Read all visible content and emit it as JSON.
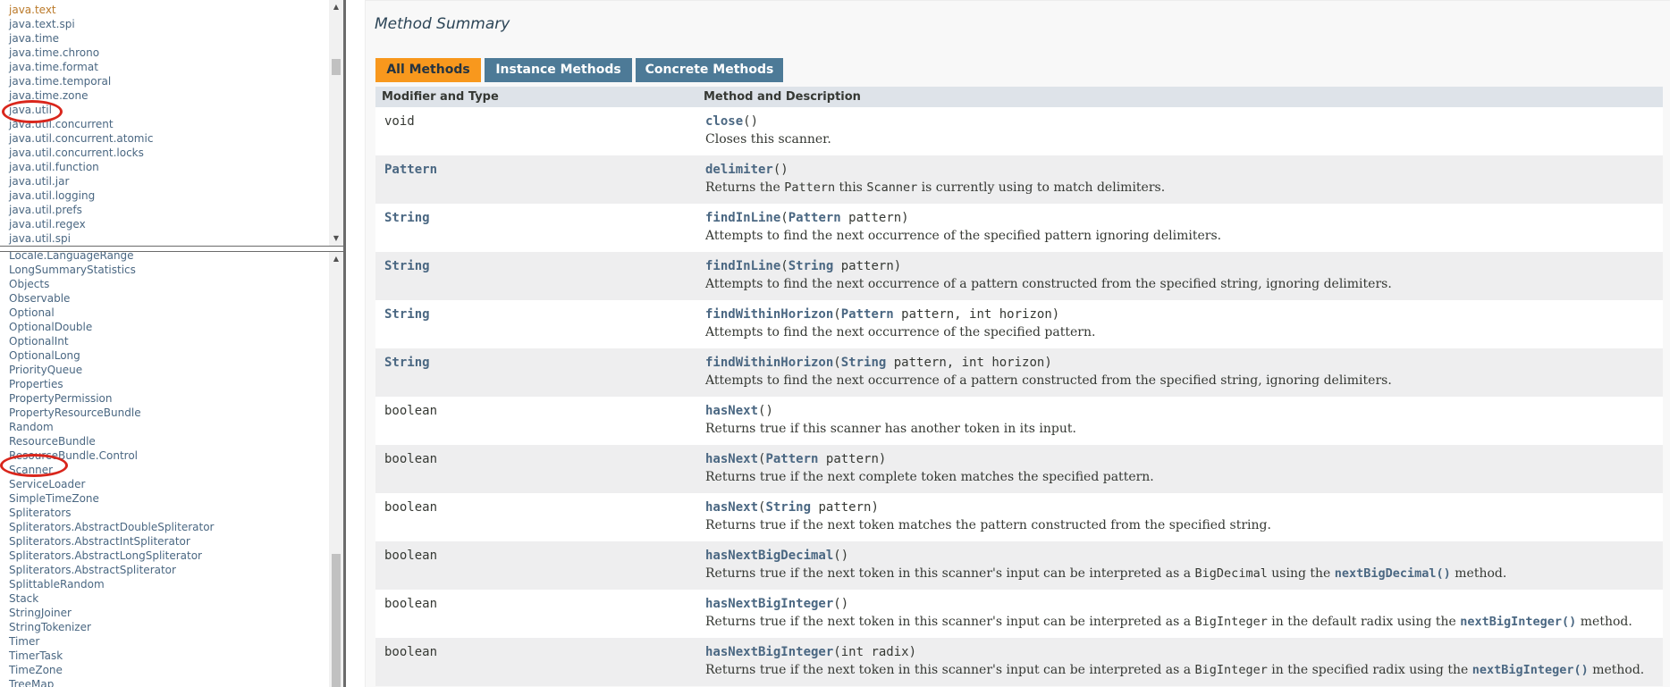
{
  "packages": [
    {
      "name": "java.text",
      "visited": true
    },
    {
      "name": "java.text.spi",
      "visited": false
    },
    {
      "name": "java.time",
      "visited": false
    },
    {
      "name": "java.time.chrono",
      "visited": false
    },
    {
      "name": "java.time.format",
      "visited": false
    },
    {
      "name": "java.time.temporal",
      "visited": false
    },
    {
      "name": "java.time.zone",
      "visited": false
    },
    {
      "name": "java.util",
      "visited": false
    },
    {
      "name": "java.util.concurrent",
      "visited": false
    },
    {
      "name": "java.util.concurrent.atomic",
      "visited": false
    },
    {
      "name": "java.util.concurrent.locks",
      "visited": false
    },
    {
      "name": "java.util.function",
      "visited": false
    },
    {
      "name": "java.util.jar",
      "visited": false
    },
    {
      "name": "java.util.logging",
      "visited": false
    },
    {
      "name": "java.util.prefs",
      "visited": false
    },
    {
      "name": "java.util.regex",
      "visited": false
    },
    {
      "name": "java.util.spi",
      "visited": false
    }
  ],
  "classes": [
    "Locale.LanguageRange",
    "LongSummaryStatistics",
    "Objects",
    "Observable",
    "Optional",
    "OptionalDouble",
    "OptionalInt",
    "OptionalLong",
    "PriorityQueue",
    "Properties",
    "PropertyPermission",
    "PropertyResourceBundle",
    "Random",
    "ResourceBundle",
    "ResourceBundle.Control",
    "Scanner",
    "ServiceLoader",
    "SimpleTimeZone",
    "Spliterators",
    "Spliterators.AbstractDoubleSpliterator",
    "Spliterators.AbstractIntSpliterator",
    "Spliterators.AbstractLongSpliterator",
    "Spliterators.AbstractSpliterator",
    "SplittableRandom",
    "Stack",
    "StringJoiner",
    "StringTokenizer",
    "Timer",
    "TimerTask",
    "TimeZone",
    "TreeMap"
  ],
  "summary": {
    "title": "Method Summary",
    "tabs": [
      "All Methods",
      "Instance Methods",
      "Concrete Methods"
    ],
    "active_tab": "All Methods",
    "col_type": "Modifier and Type",
    "col_method": "Method and Description"
  },
  "methods": [
    {
      "type": "void",
      "type_link": false,
      "sig": [
        [
          "m",
          "close"
        ],
        [
          "t",
          "()"
        ]
      ],
      "desc": [
        [
          "t",
          "Closes this scanner."
        ]
      ]
    },
    {
      "type": "Pattern",
      "type_link": true,
      "sig": [
        [
          "m",
          "delimiter"
        ],
        [
          "t",
          "()"
        ]
      ],
      "desc": [
        [
          "t",
          "Returns the "
        ],
        [
          "c",
          "Pattern"
        ],
        [
          "t",
          " this "
        ],
        [
          "c",
          "Scanner"
        ],
        [
          "t",
          " is currently using to match delimiters."
        ]
      ]
    },
    {
      "type": "String",
      "type_link": true,
      "sig": [
        [
          "m",
          "findInLine"
        ],
        [
          "t",
          "("
        ],
        [
          "p",
          "Pattern"
        ],
        [
          "t",
          " pattern)"
        ]
      ],
      "desc": [
        [
          "t",
          "Attempts to find the next occurrence of the specified pattern ignoring delimiters."
        ]
      ]
    },
    {
      "type": "String",
      "type_link": true,
      "sig": [
        [
          "m",
          "findInLine"
        ],
        [
          "t",
          "("
        ],
        [
          "p",
          "String"
        ],
        [
          "t",
          " pattern)"
        ]
      ],
      "desc": [
        [
          "t",
          "Attempts to find the next occurrence of a pattern constructed from the specified string, ignoring delimiters."
        ]
      ]
    },
    {
      "type": "String",
      "type_link": true,
      "sig": [
        [
          "m",
          "findWithinHorizon"
        ],
        [
          "t",
          "("
        ],
        [
          "p",
          "Pattern"
        ],
        [
          "t",
          " pattern, int horizon)"
        ]
      ],
      "desc": [
        [
          "t",
          "Attempts to find the next occurrence of the specified pattern."
        ]
      ]
    },
    {
      "type": "String",
      "type_link": true,
      "sig": [
        [
          "m",
          "findWithinHorizon"
        ],
        [
          "t",
          "("
        ],
        [
          "p",
          "String"
        ],
        [
          "t",
          " pattern, int horizon)"
        ]
      ],
      "desc": [
        [
          "t",
          "Attempts to find the next occurrence of a pattern constructed from the specified string, ignoring delimiters."
        ]
      ]
    },
    {
      "type": "boolean",
      "type_link": false,
      "sig": [
        [
          "m",
          "hasNext"
        ],
        [
          "t",
          "()"
        ]
      ],
      "desc": [
        [
          "t",
          "Returns true if this scanner has another token in its input."
        ]
      ]
    },
    {
      "type": "boolean",
      "type_link": false,
      "sig": [
        [
          "m",
          "hasNext"
        ],
        [
          "t",
          "("
        ],
        [
          "p",
          "Pattern"
        ],
        [
          "t",
          " pattern)"
        ]
      ],
      "desc": [
        [
          "t",
          "Returns true if the next complete token matches the specified pattern."
        ]
      ]
    },
    {
      "type": "boolean",
      "type_link": false,
      "sig": [
        [
          "m",
          "hasNext"
        ],
        [
          "t",
          "("
        ],
        [
          "p",
          "String"
        ],
        [
          "t",
          " pattern)"
        ]
      ],
      "desc": [
        [
          "t",
          "Returns true if the next token matches the pattern constructed from the specified string."
        ]
      ]
    },
    {
      "type": "boolean",
      "type_link": false,
      "sig": [
        [
          "m",
          "hasNextBigDecimal"
        ],
        [
          "t",
          "()"
        ]
      ],
      "desc": [
        [
          "t",
          "Returns true if the next token in this scanner's input can be interpreted as a "
        ],
        [
          "c",
          "BigDecimal"
        ],
        [
          "t",
          " using the "
        ],
        [
          "l",
          "nextBigDecimal()"
        ],
        [
          "t",
          " method."
        ]
      ]
    },
    {
      "type": "boolean",
      "type_link": false,
      "sig": [
        [
          "m",
          "hasNextBigInteger"
        ],
        [
          "t",
          "()"
        ]
      ],
      "desc": [
        [
          "t",
          "Returns true if the next token in this scanner's input can be interpreted as a "
        ],
        [
          "c",
          "BigInteger"
        ],
        [
          "t",
          " in the default radix using the "
        ],
        [
          "l",
          "nextBigInteger()"
        ],
        [
          "t",
          " method."
        ]
      ]
    },
    {
      "type": "boolean",
      "type_link": false,
      "sig": [
        [
          "m",
          "hasNextBigInteger"
        ],
        [
          "t",
          "(int radix)"
        ]
      ],
      "desc": [
        [
          "t",
          "Returns true if the next token in this scanner's input can be interpreted as a "
        ],
        [
          "c",
          "BigInteger"
        ],
        [
          "t",
          " in the specified radix using the "
        ],
        [
          "l",
          "nextBigInteger()"
        ],
        [
          "t",
          " method."
        ]
      ]
    }
  ]
}
